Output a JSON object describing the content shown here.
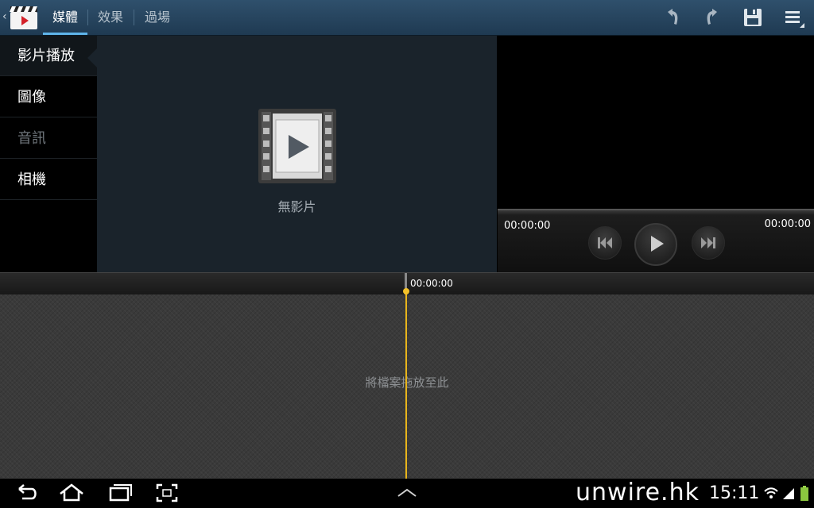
{
  "tabs": [
    {
      "label": "媒體",
      "active": true
    },
    {
      "label": "效果",
      "active": false
    },
    {
      "label": "過場",
      "active": false
    }
  ],
  "actions": {
    "undo_icon": "undo-icon",
    "redo_icon": "redo-icon",
    "save_icon": "save-icon",
    "menu_icon": "menu-icon"
  },
  "sidebar": {
    "items": [
      {
        "label": "影片播放",
        "selected": true
      },
      {
        "label": "圖像",
        "selected": false
      },
      {
        "label": "音訊",
        "selected": false,
        "dimmed": true
      },
      {
        "label": "相機",
        "selected": false
      }
    ]
  },
  "media": {
    "empty_label": "無影片"
  },
  "player": {
    "time_start": "00:00:00",
    "time_end": "00:00:00"
  },
  "timeline": {
    "ruler_time": "00:00:00",
    "drop_hint": "將檔案拖放至此"
  },
  "status": {
    "watermark": "unwire.hk",
    "clock": "15:11"
  },
  "colors": {
    "accent": "#5fb4ea",
    "playhead": "#e8b51c",
    "actionbar": "#2a4861"
  }
}
